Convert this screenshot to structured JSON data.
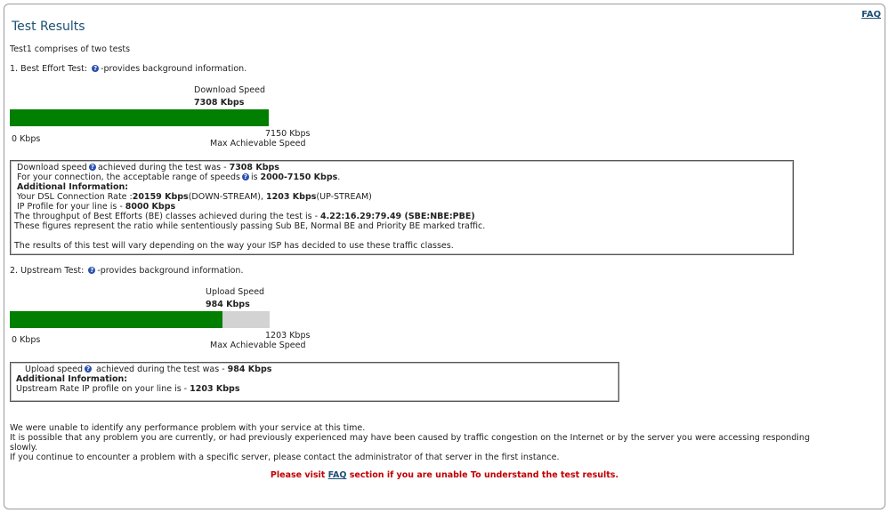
{
  "header": {
    "title": "Test Results",
    "faq_link": "FAQ"
  },
  "intro": "Test1 comprises of two tests",
  "help_icon": "info-circle-icon",
  "colors": {
    "bar_fill": "#007f00",
    "bar_track": "#d3d3d3",
    "title": "#1d4f73",
    "notice": "#c00000"
  },
  "best_effort": {
    "heading_prefix": "1. Best Effort Test:",
    "heading_suffix": "-provides background information.",
    "speed_label": "Download Speed",
    "speed_value": "7308 Kbps",
    "bar_fill_fraction": 1.0,
    "scale_min": "0 Kbps",
    "scale_max": "7150 Kbps",
    "scale_max_label": "Max Achievable Speed",
    "details": {
      "l1_prefix": "Download speed",
      "l1_mid": "achieved during the test was - ",
      "l1_value": "7308 Kbps",
      "l2_prefix": "For your connection, the acceptable range of speeds",
      "l2_mid": "is ",
      "l2_value": "2000-7150 Kbps",
      "l2_suffix": ".",
      "additional_heading": "Additional Information:",
      "l4_prefix": "Your DSL Connection Rate :",
      "l4_down": "20159 Kbps",
      "l4_down_suffix": "(DOWN-STREAM), ",
      "l4_up": "1203 Kbps",
      "l4_up_suffix": "(UP-STREAM)",
      "l5_prefix": "IP Profile for your line is - ",
      "l5_value": "8000 Kbps",
      "l6_prefix": "The throughput of Best Efforts (BE) classes achieved during the test is - ",
      "l6_value": "4.22:16.29:79.49 (SBE:NBE:PBE)",
      "l7": "These figures represent the ratio while sententiously passing Sub BE, Normal BE and Priority BE marked traffic.",
      "l8": "The results of this test will vary depending on the way your ISP has decided to use these traffic classes."
    }
  },
  "upstream": {
    "heading_prefix": "2. Upstream Test:",
    "heading_suffix": "-provides background information.",
    "speed_label": "Upload Speed",
    "speed_value": "984 Kbps",
    "bar_fill_fraction": 0.818,
    "scale_min": "0 Kbps",
    "scale_max": "1203 Kbps",
    "scale_max_label": "Max Achievable Speed",
    "details": {
      "l1_prefix": "Upload speed",
      "l1_mid": " achieved during the test was - ",
      "l1_value": "984 Kbps",
      "additional_heading": "Additional Information:",
      "l3_prefix": "Upstream Rate IP profile on your line is - ",
      "l3_value": "1203 Kbps"
    }
  },
  "footer": {
    "p1": "We were unable to identify any performance problem with your service at this time.",
    "p2a": "It is possible that any problem you are currently, or had previously experienced may have been caused by traffic congestion on the Internet or by the server you were accessing responding",
    "p2b": "slowly.",
    "p3": "If you continue to encounter a problem with a specific server, please contact the administrator of that server in the first instance.",
    "notice_prefix": "Please visit ",
    "notice_link": "FAQ",
    "notice_suffix": " section if you are unable To understand the test results."
  }
}
